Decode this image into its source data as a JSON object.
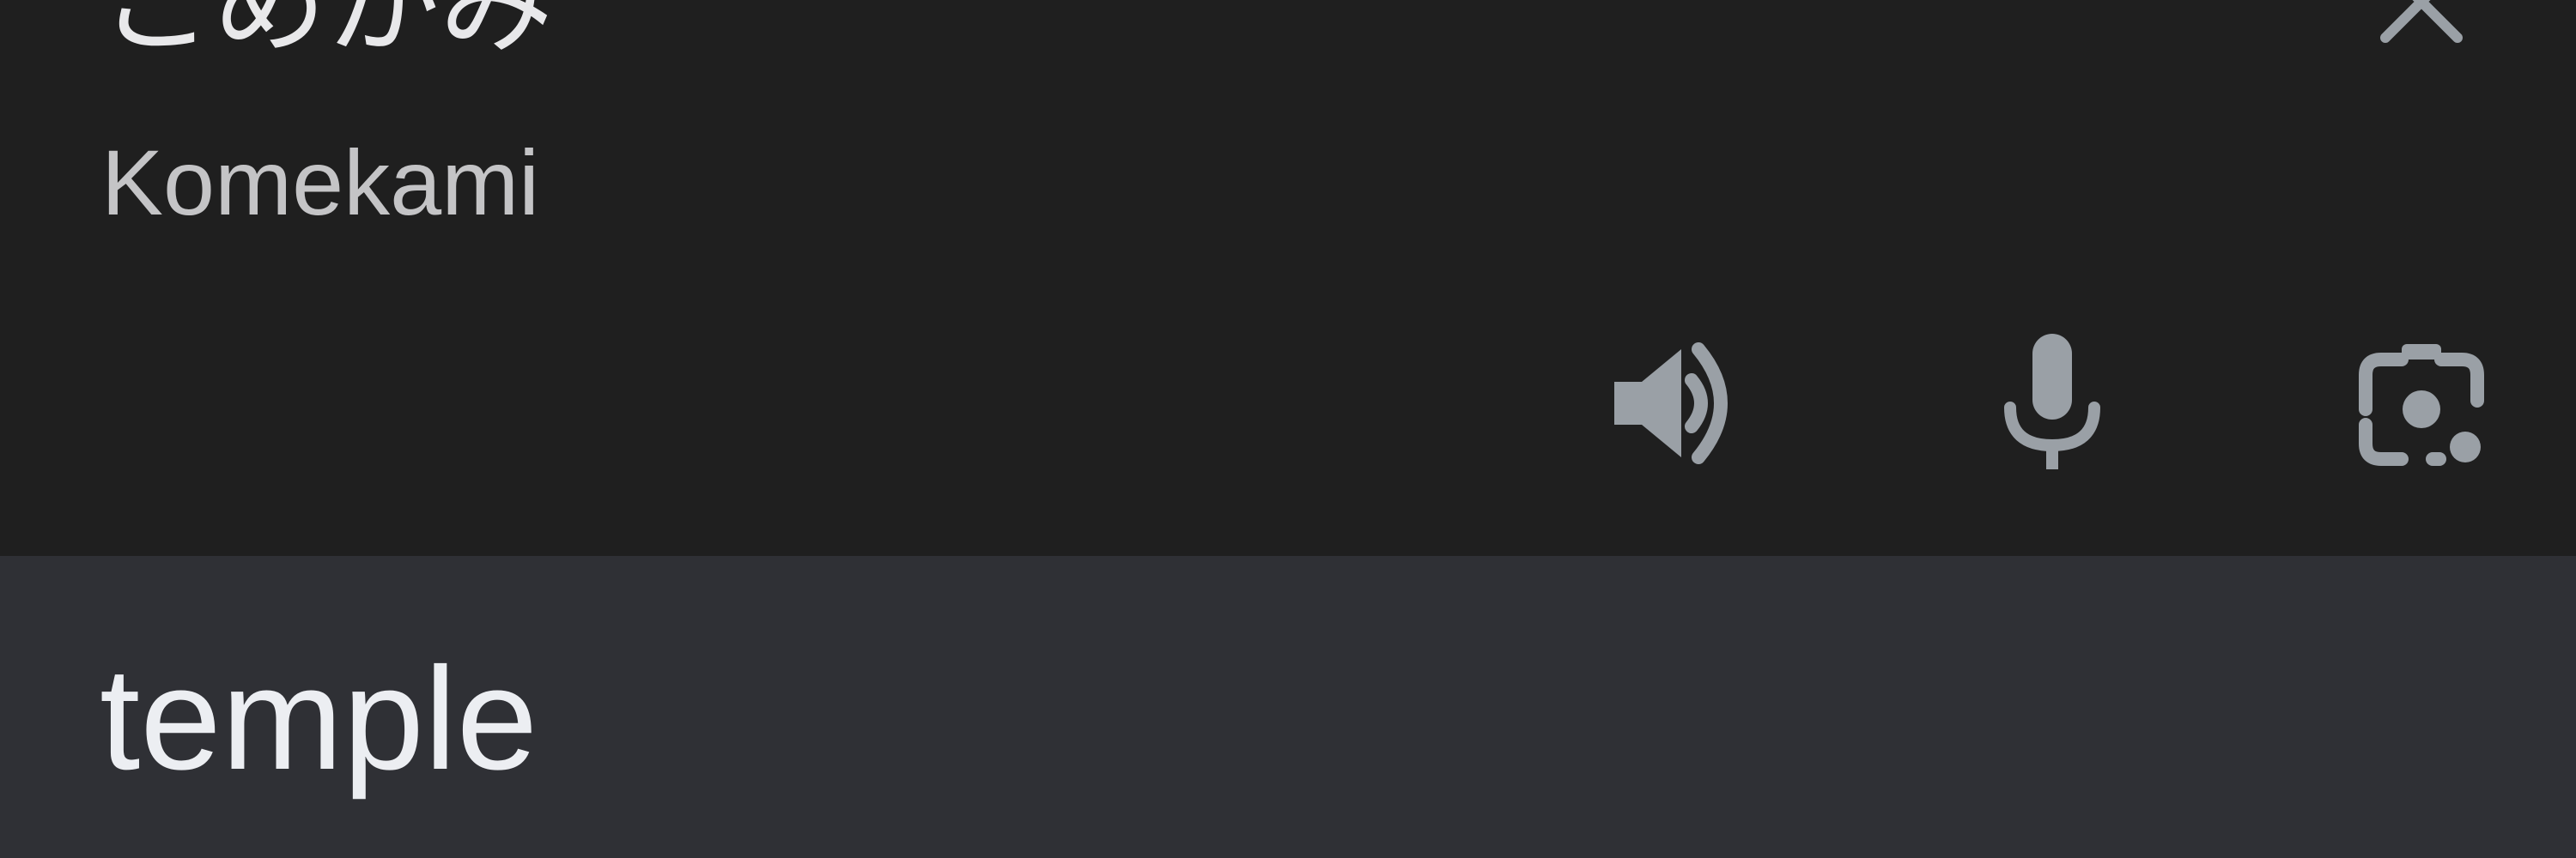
{
  "source": {
    "text": "こめかみ",
    "romanization": "Komekami"
  },
  "target": {
    "text": "temple"
  },
  "icons": {
    "close": "close-icon",
    "speaker": "speaker-icon",
    "mic": "microphone-icon",
    "lens": "camera-lens-icon"
  },
  "colors": {
    "source_bg": "#1f1f1f",
    "target_bg": "#2f3035",
    "icon": "#9aa0a6",
    "text_primary": "#eceef2",
    "text_secondary": "#c4c4c6"
  }
}
